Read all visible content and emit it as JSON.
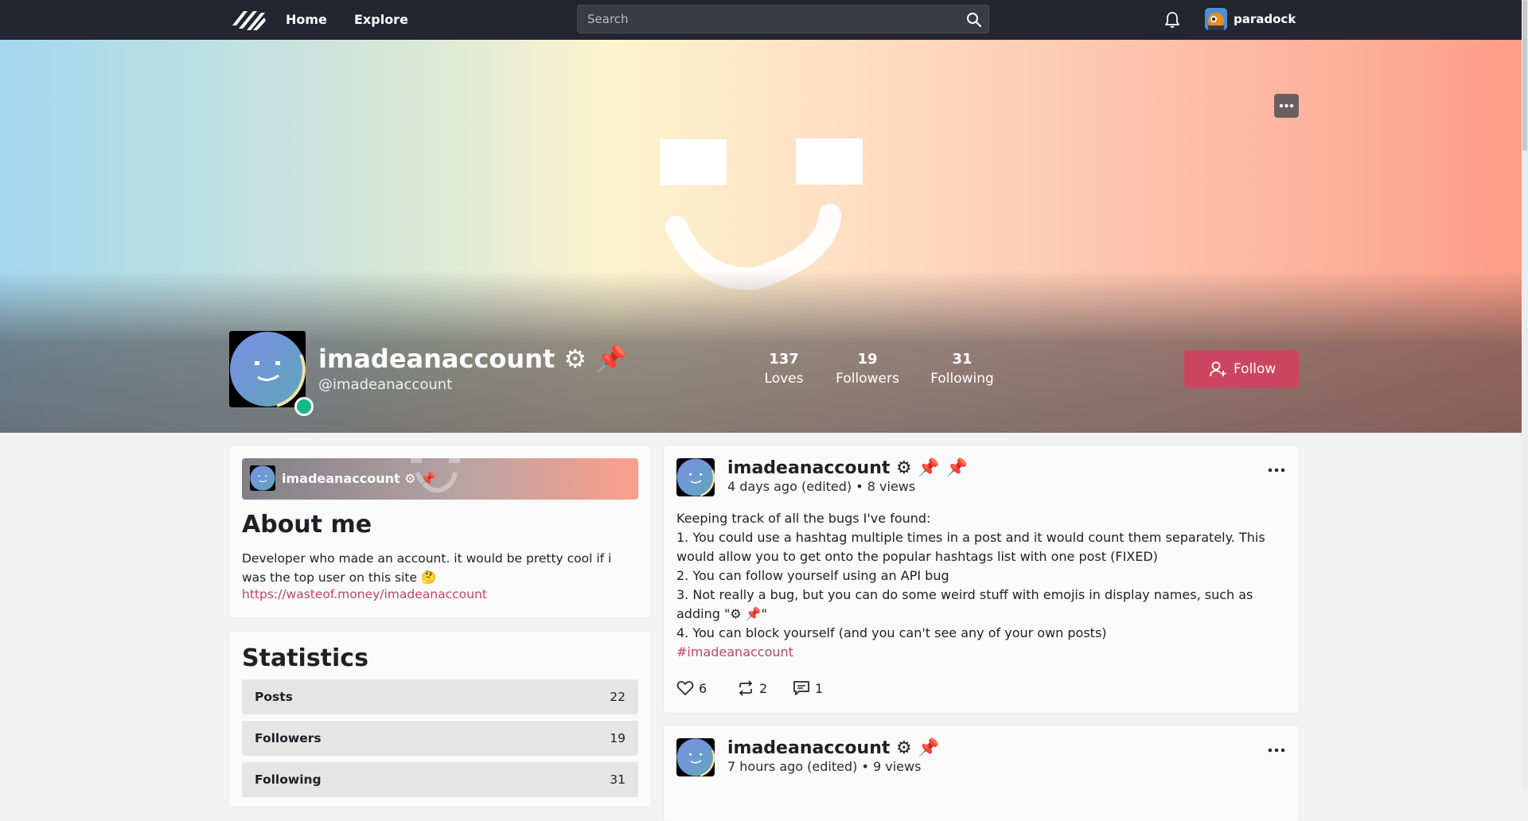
{
  "nav": {
    "home": "Home",
    "explore": "Explore",
    "search_placeholder": "Search",
    "username": "paradock",
    "icons": [
      "logo-icon",
      "search-icon",
      "bell-icon"
    ]
  },
  "profile": {
    "name": "imadeanaccount ⚙ 📌",
    "handle": "@imadeanaccount",
    "stats": [
      {
        "value": "137",
        "label": "Loves"
      },
      {
        "value": "19",
        "label": "Followers"
      },
      {
        "value": "31",
        "label": "Following"
      }
    ],
    "follow_label": "Follow"
  },
  "about": {
    "mini_name": "imadeanaccount ⚙ 📌",
    "title": "About me",
    "text": "Developer who made an account. it would be pretty cool if i was the top user on this site 🤔",
    "link": "https://wasteof.money/imadeanaccount"
  },
  "statistics": {
    "title": "Statistics",
    "rows": [
      {
        "label": "Posts",
        "value": "22"
      },
      {
        "label": "Followers",
        "value": "19"
      },
      {
        "label": "Following",
        "value": "31"
      }
    ]
  },
  "posts": [
    {
      "name": "imadeanaccount ⚙ 📌 📌",
      "meta": "4 days ago (edited) • 8 views",
      "lines": [
        "Keeping track of all the bugs I've found:",
        "1. You could use a hashtag multiple times in a post and it would count them separately. This would allow you to get onto the popular hashtags list with one post (FIXED)",
        "2. You can follow yourself using an API bug",
        "3. Not really a bug, but you can do some weird stuff with emojis in display names, such as adding \"⚙ 📌\"",
        "4. You can block yourself (and you can't see any of your own posts)"
      ],
      "hashtag": "#imadeanaccount",
      "likes": "6",
      "reposts": "2",
      "comments": "1"
    },
    {
      "name": "imadeanaccount ⚙ 📌",
      "meta": "7 hours ago (edited) • 9 views"
    }
  ],
  "colors": {
    "topbar": "#242531",
    "accent": "#cc4660",
    "link": "#c0475f",
    "online": "#14b888"
  }
}
